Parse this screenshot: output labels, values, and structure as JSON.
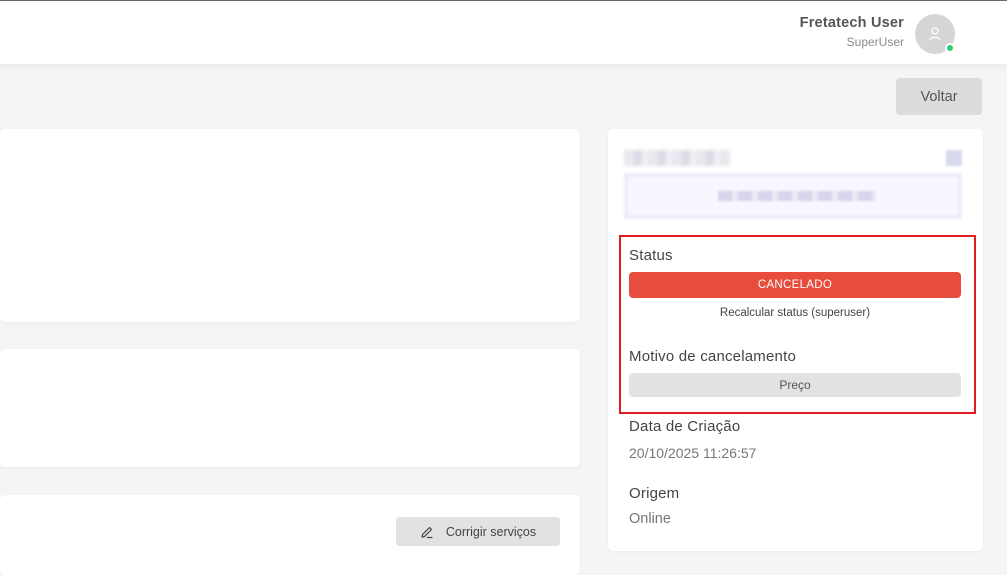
{
  "header": {
    "user_name": "Fretatech User",
    "user_role": "SuperUser",
    "online_color": "#2ecc71"
  },
  "toolbar": {
    "back_label": "Voltar"
  },
  "services": {
    "fix_label": "Corrigir serviços"
  },
  "sidebar": {
    "status_label": "Status",
    "status_value": "CANCELADO",
    "status_color": "#e74c3c",
    "recalc_label": "Recalcular status (superuser)",
    "reason_label": "Motivo de cancelamento",
    "reason_value": "Preço",
    "created_label": "Data de Criação",
    "created_value": "20/10/2025 11:26:57",
    "origin_label": "Origem",
    "origin_value": "Online"
  }
}
